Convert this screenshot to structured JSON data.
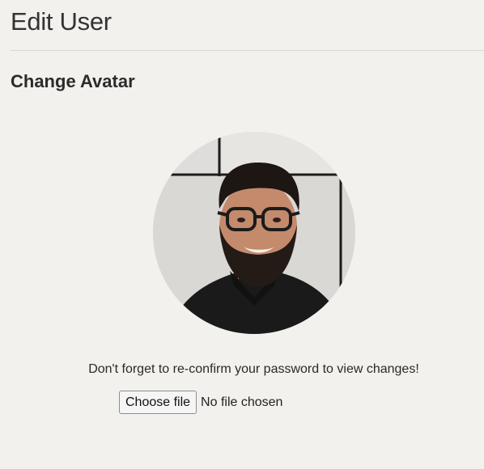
{
  "header": {
    "title": "Edit User"
  },
  "section": {
    "title": "Change Avatar"
  },
  "avatar": {
    "icon": "user-avatar-photo"
  },
  "hint": {
    "text": "Don't forget to re-confirm your password to view changes!"
  },
  "file_input": {
    "button_label": "Choose file",
    "status": "No file chosen"
  }
}
